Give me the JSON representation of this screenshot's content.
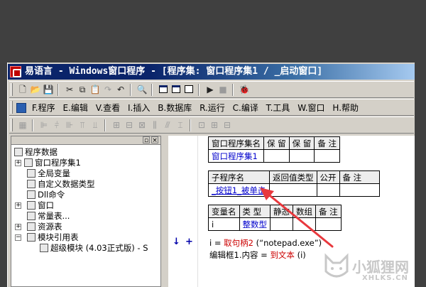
{
  "window": {
    "title": "易语言 - Windows窗口程序 - [程序集: 窗口程序集1 / _启动窗口]"
  },
  "menu": {
    "items": [
      {
        "label": "F.程序"
      },
      {
        "label": "E.编辑"
      },
      {
        "label": "V.查看"
      },
      {
        "label": "I.插入"
      },
      {
        "label": "B.数据库"
      },
      {
        "label": "R.运行"
      },
      {
        "label": "C.编译"
      },
      {
        "label": "T.工具"
      },
      {
        "label": "W.窗口"
      },
      {
        "label": "H.帮助"
      }
    ]
  },
  "toolbar": {
    "undo": "↶",
    "redo": "↷"
  },
  "tree": {
    "items": [
      {
        "label": "程序数据",
        "icon": "program-data-icon"
      },
      {
        "label": "窗口程序集1",
        "icon": "assembly-icon"
      },
      {
        "label": "全局变量",
        "icon": "global-var-icon"
      },
      {
        "label": "自定义数据类型",
        "icon": "datatype-icon"
      },
      {
        "label": "Dll命令",
        "icon": "dll-icon"
      },
      {
        "label": "窗口",
        "icon": "window-icon"
      },
      {
        "label": "常量表...",
        "icon": "constant-icon"
      },
      {
        "label": "资源表",
        "icon": "resource-icon"
      },
      {
        "label": "模块引用表",
        "icon": "module-ref-icon"
      },
      {
        "label": "超级模块 (4.03正式版) - S",
        "icon": "module-icon"
      }
    ]
  },
  "editor": {
    "assembly_table": {
      "headers": [
        "窗口程序集名",
        "保 留",
        "保 留",
        "备 注"
      ],
      "row": [
        "窗口程序集1",
        "",
        "",
        ""
      ]
    },
    "sub_table": {
      "headers": [
        "子程序名",
        "返回值类型",
        "公开",
        "备 注"
      ],
      "row": [
        "_按钮1_被单击",
        "",
        "",
        ""
      ]
    },
    "var_table": {
      "headers": [
        "变量名",
        "类 型",
        "静态",
        "数组",
        "备 注"
      ],
      "row": [
        "i",
        "整数型",
        "",
        "",
        ""
      ]
    },
    "code": {
      "line1_a": "i = ",
      "line1_b": "取句柄2",
      "line1_c": " (“notepad.exe”)",
      "line2_a": "编辑框1",
      "line2_b": ".内容 = ",
      "line2_c": "到文本",
      "line2_d": " (i)"
    }
  },
  "watermark": {
    "text": "小狐狸网",
    "url": "XHLKS.CN"
  },
  "colors": {
    "accent": "#0a246a",
    "arrow": "#e8383d"
  }
}
